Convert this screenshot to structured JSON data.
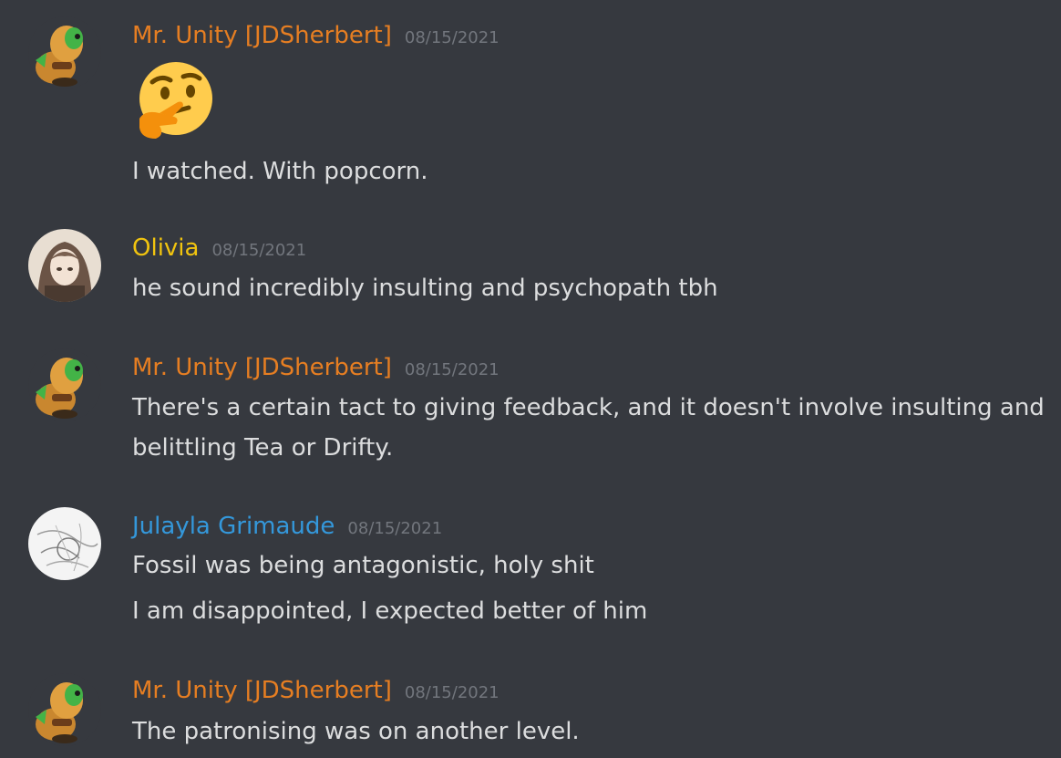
{
  "colors": {
    "background": "#36393f",
    "text": "#dcddde",
    "timestamp": "#72767d",
    "mr_unity": "#e67e22",
    "olivia": "#f1c40f",
    "julayla": "#3498db"
  },
  "messages": [
    {
      "author": "Mr. Unity [JDSherbert]",
      "timestamp": "08/15/2021",
      "emoji": "thinking-face",
      "lines": [
        "I watched. With popcorn."
      ]
    },
    {
      "author": "Olivia",
      "timestamp": "08/15/2021",
      "lines": [
        "he sound incredibly insulting and psychopath tbh"
      ]
    },
    {
      "author": "Mr. Unity [JDSherbert]",
      "timestamp": "08/15/2021",
      "lines": [
        "There's a certain tact to giving feedback, and it doesn't involve insulting and",
        "belittling Tea or Drifty."
      ]
    },
    {
      "author": "Julayla Grimaude",
      "timestamp": "08/15/2021",
      "lines": [
        "Fossil was being antagonistic, holy shit",
        "I am disappointed, I expected better of him"
      ]
    },
    {
      "author": "Mr. Unity [JDSherbert]",
      "timestamp": "08/15/2021",
      "lines": [
        "The patronising was on another level."
      ]
    }
  ]
}
